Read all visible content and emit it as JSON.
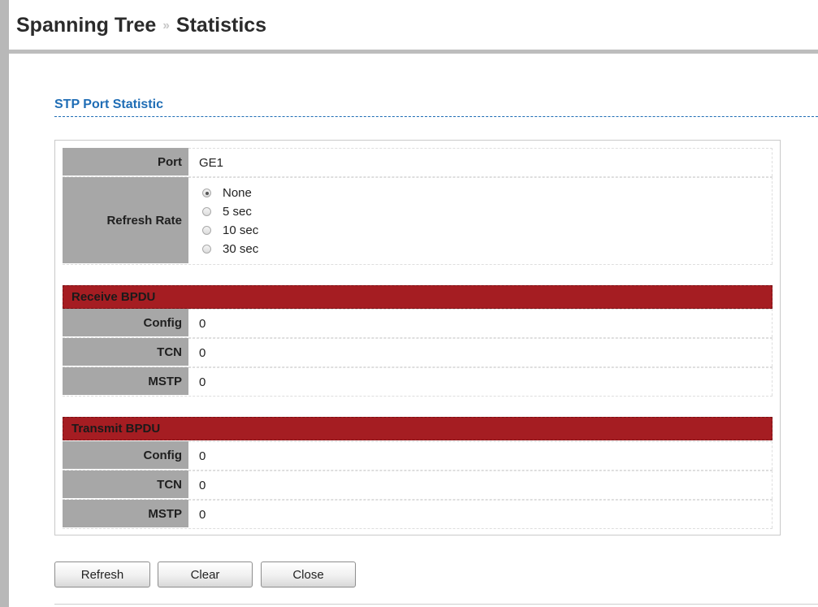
{
  "header": {
    "breadcrumb_parent": "Spanning Tree",
    "breadcrumb_separator": "››",
    "breadcrumb_current": "Statistics"
  },
  "section": {
    "title": "STP Port Statistic"
  },
  "port": {
    "label": "Port",
    "value": "GE1"
  },
  "refresh_rate": {
    "label": "Refresh Rate",
    "selected": "None",
    "options": [
      "None",
      "5 sec",
      "10 sec",
      "30 sec"
    ]
  },
  "receive_bpdu": {
    "title": "Receive BPDU",
    "rows": [
      {
        "label": "Config",
        "value": "0"
      },
      {
        "label": "TCN",
        "value": "0"
      },
      {
        "label": "MSTP",
        "value": "0"
      }
    ]
  },
  "transmit_bpdu": {
    "title": "Transmit BPDU",
    "rows": [
      {
        "label": "Config",
        "value": "0"
      },
      {
        "label": "TCN",
        "value": "0"
      },
      {
        "label": "MSTP",
        "value": "0"
      }
    ]
  },
  "buttons": {
    "refresh": "Refresh",
    "clear": "Clear",
    "close": "Close"
  },
  "colors": {
    "section_title": "#1f6db5",
    "band": "#a51d22",
    "label_cell": "#a7a7a7"
  }
}
